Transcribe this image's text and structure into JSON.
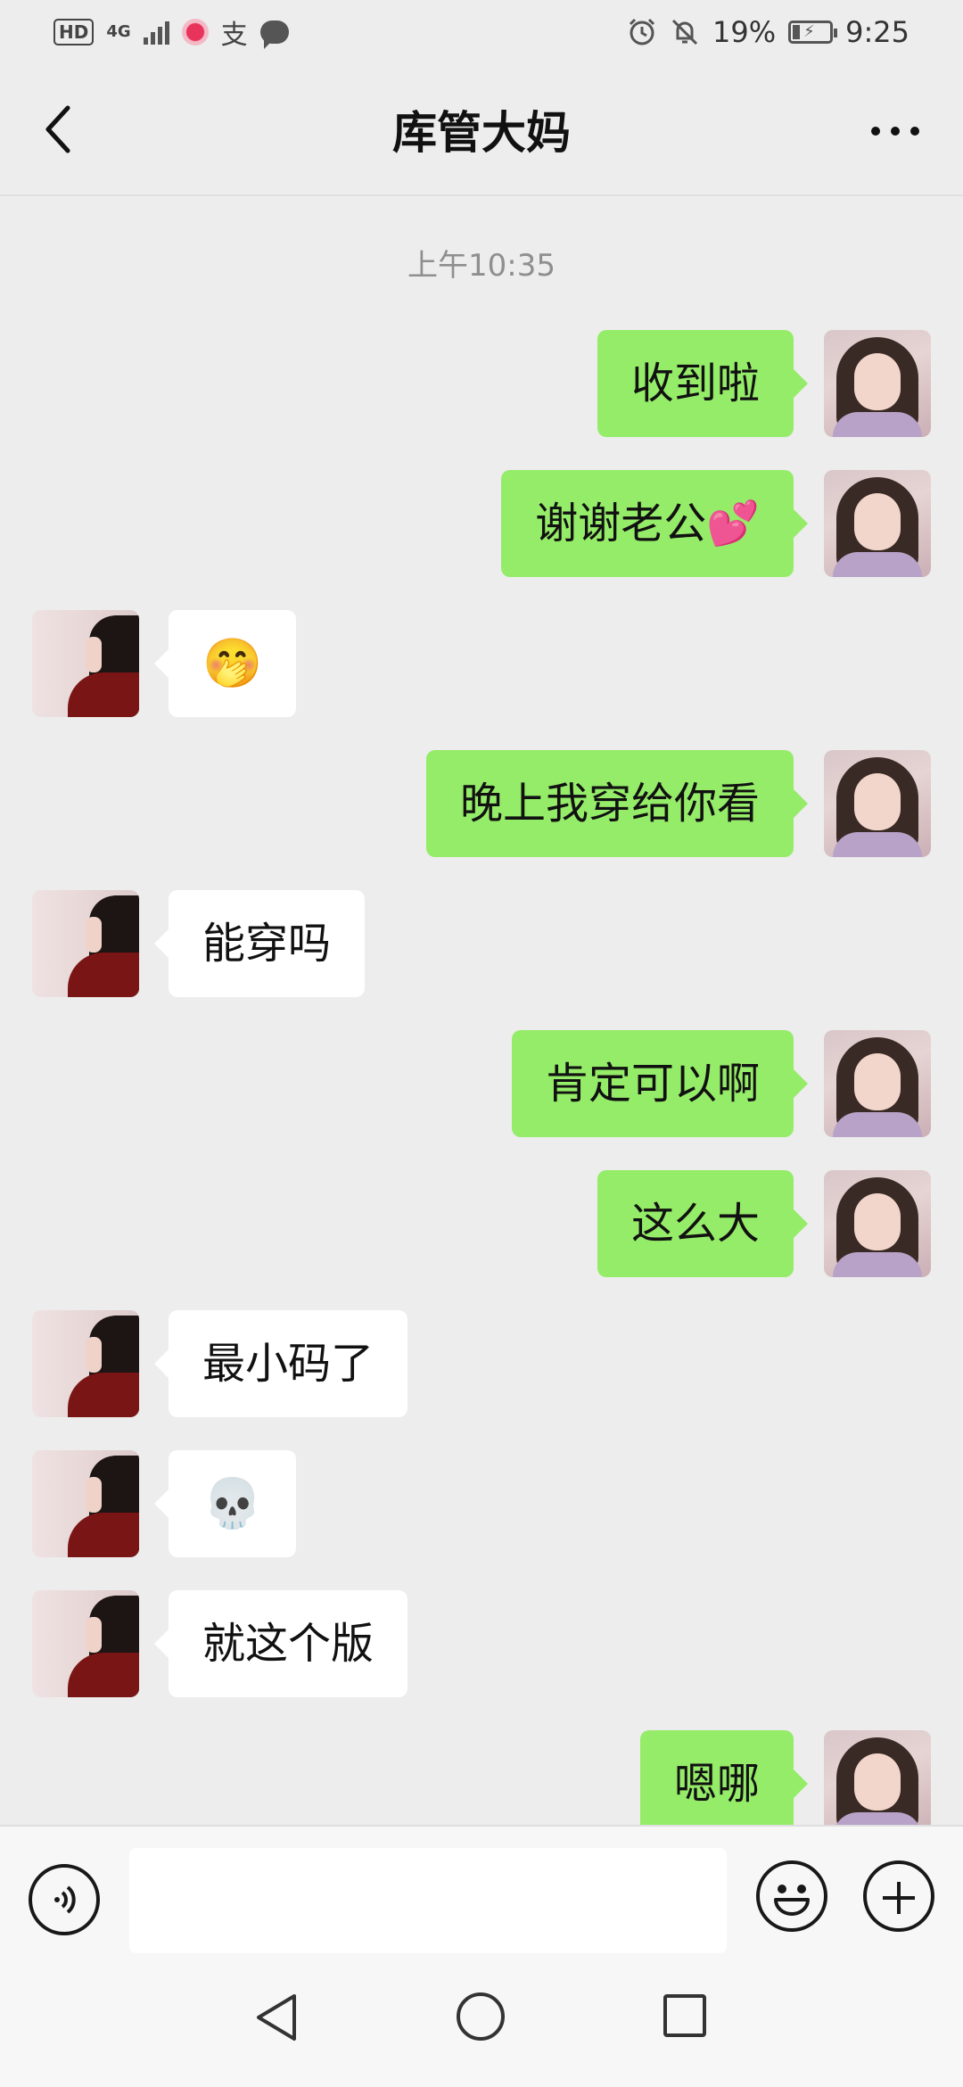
{
  "status_bar": {
    "hd_label": "HD",
    "network_label": "4G",
    "app_label": "支",
    "battery_percent": "19%",
    "time": "9:25"
  },
  "header": {
    "title": "库管大妈",
    "back_icon": "chevron-left-icon",
    "more_icon": "more-dots-icon"
  },
  "chat": {
    "timestamp": "上午10:35",
    "messages": [
      {
        "sender": "self",
        "text": "收到啦"
      },
      {
        "sender": "self",
        "text": "谢谢老公💕"
      },
      {
        "sender": "other",
        "text": "🤭"
      },
      {
        "sender": "self",
        "text": "晚上我穿给你看"
      },
      {
        "sender": "other",
        "text": "能穿吗"
      },
      {
        "sender": "self",
        "text": "肯定可以啊"
      },
      {
        "sender": "self",
        "text": "这么大"
      },
      {
        "sender": "other",
        "text": "最小码了"
      },
      {
        "sender": "other",
        "text": "💀"
      },
      {
        "sender": "other",
        "text": "就这个版"
      },
      {
        "sender": "self",
        "text": "嗯哪"
      }
    ],
    "self_bubble_color": "#95ec69",
    "other_bubble_color": "#ffffff",
    "background_color": "#ededed"
  },
  "input_bar": {
    "voice_icon": "voice-icon",
    "emoji_icon": "emoji-icon",
    "plus_icon": "plus-icon",
    "text_value": ""
  },
  "nav_bar": {
    "back_icon": "nav-back-icon",
    "home_icon": "nav-home-icon",
    "recent_icon": "nav-recent-icon"
  }
}
